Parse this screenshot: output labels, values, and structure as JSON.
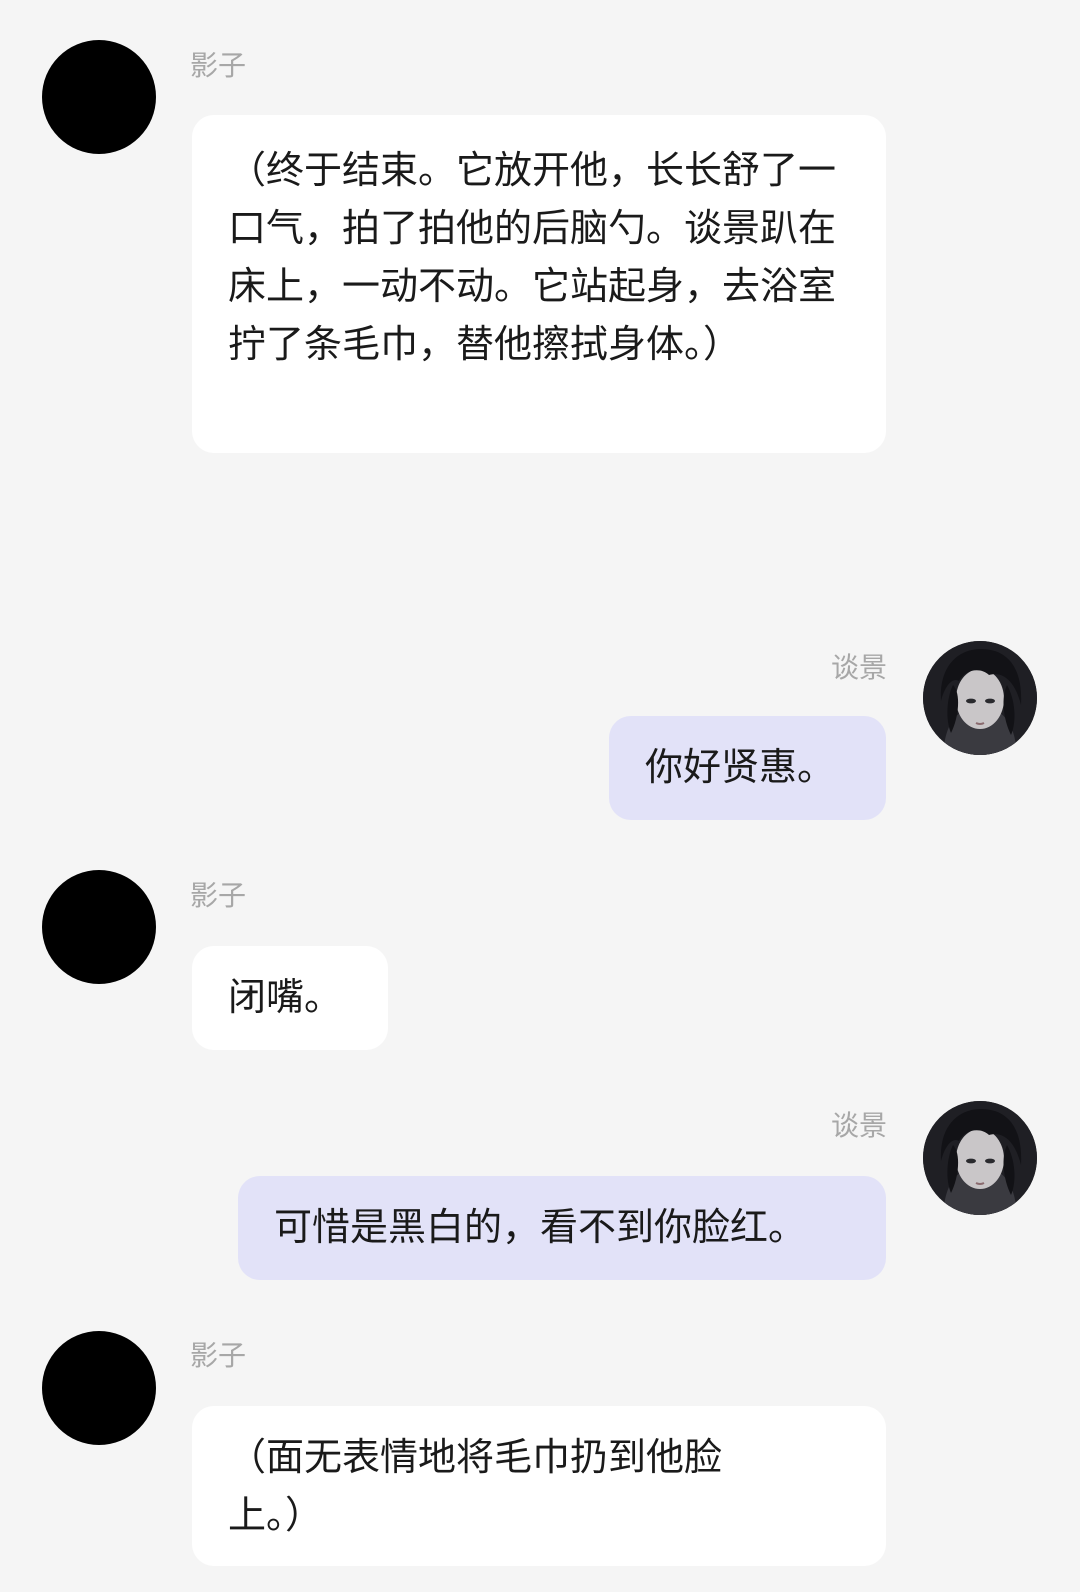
{
  "chat": {
    "messages": [
      {
        "sender": "影子",
        "side": "left",
        "text": "（终于结束。它放开他，长长舒了一口气，拍了拍他的后脑勺。谈景趴在床上，一动不动。它站起身，去浴室拧了条毛巾，替他擦拭身体。）"
      },
      {
        "sender": "谈景",
        "side": "right",
        "text": "你好贤惠。"
      },
      {
        "sender": "影子",
        "side": "left",
        "text": "闭嘴。"
      },
      {
        "sender": "谈景",
        "side": "right",
        "text": "可惜是黑白的，看不到你脸红。"
      },
      {
        "sender": "影子",
        "side": "left",
        "text": "（面无表情地将毛巾扔到他脸上。）"
      }
    ]
  },
  "colors": {
    "background": "#f5f5f5",
    "left_bubble": "#ffffff",
    "right_bubble": "#e2e2f8",
    "name_text": "#a7a7a7"
  }
}
